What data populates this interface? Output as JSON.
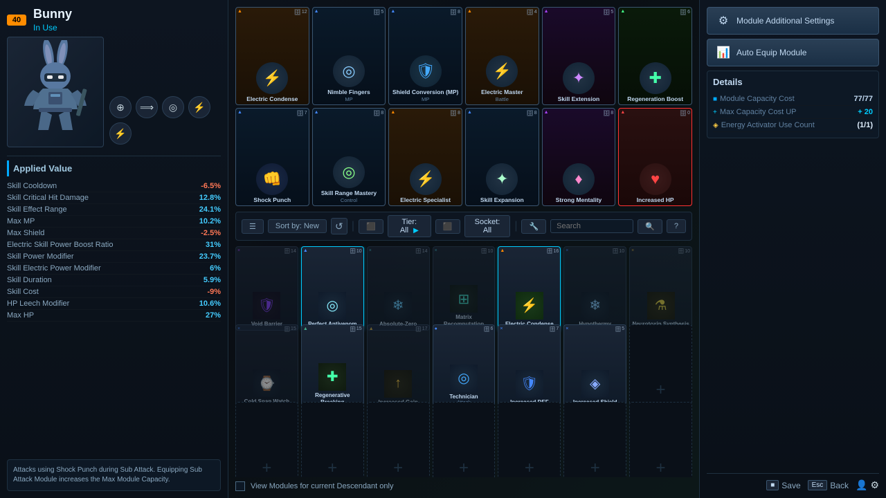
{
  "character": {
    "level": "40",
    "name": "Bunny",
    "status": "In Use"
  },
  "icons": {
    "target": "⊕",
    "arrow": "⟹",
    "settings": "⚙",
    "lightning": "⚡",
    "lightning2": "⚡",
    "shield_icon": "🛡",
    "refresh": "↺",
    "layers": "≡",
    "search": "🔍",
    "question": "?",
    "filter": "⊞",
    "checkbox_empty": "",
    "gear": "⚙",
    "bar": "▰",
    "save": "💾",
    "back_key": "Esc"
  },
  "equipped_modules": [
    {
      "name": "Electric Condense",
      "sub": "",
      "icon": "⚡",
      "badge": "12",
      "badge_left": "▲",
      "type": "orange"
    },
    {
      "name": "Nimble Fingers",
      "sub": "MP",
      "icon": "◎",
      "badge": "5",
      "badge_left": "▲",
      "type": "blue"
    },
    {
      "name": "Shield Conversion (MP)",
      "sub": "MP",
      "icon": "🛡",
      "badge": "8",
      "badge_left": "▲",
      "type": "blue"
    },
    {
      "name": "Electric Master",
      "sub": "Battle",
      "icon": "⚡",
      "badge": "4",
      "badge_left": "▲",
      "type": "orange"
    },
    {
      "name": "Skill Extension",
      "sub": "",
      "icon": "✦",
      "badge": "5",
      "badge_left": "▲",
      "type": "purple"
    },
    {
      "name": "Regeneration Boost",
      "sub": "",
      "icon": "✚",
      "badge": "6",
      "badge_left": "▲",
      "type": "green"
    },
    {
      "name": "Shock Punch",
      "sub": "",
      "icon": "👊",
      "badge": "7",
      "badge_left": "▲",
      "type": "blue"
    },
    {
      "name": "Skill Range Mastery",
      "sub": "Control",
      "icon": "◎",
      "badge": "8",
      "badge_left": "▲",
      "type": "blue"
    },
    {
      "name": "Electric Specialist",
      "sub": "",
      "icon": "⚡",
      "badge": "8",
      "badge_left": "▲",
      "type": "orange"
    },
    {
      "name": "Skill Expansion",
      "sub": "",
      "icon": "✦",
      "badge": "8",
      "badge_left": "▲",
      "type": "blue"
    },
    {
      "name": "Strong Mentality",
      "sub": "",
      "icon": "♦",
      "badge": "8",
      "badge_left": "▲",
      "type": "purple"
    },
    {
      "name": "Increased HP",
      "sub": "",
      "icon": "♥",
      "badge": "0",
      "badge_left": "▲",
      "type": "red"
    }
  ],
  "filter_bar": {
    "sort_label": "Sort by: New",
    "tier_label": "Tier: All",
    "socket_label": "Socket: All",
    "search_placeholder": "Search"
  },
  "inventory_modules": [
    {
      "name": "Void Barrier",
      "sub": "",
      "icon": "🛡",
      "badge": "14",
      "badge_left": "×",
      "type": "purple",
      "active": false,
      "dimmed": true
    },
    {
      "name": "Perfect Antivenom",
      "sub": "",
      "icon": "◎",
      "badge": "10",
      "badge_left": "▲",
      "type": "blue",
      "active": true,
      "dimmed": false
    },
    {
      "name": "Absolute-Zero",
      "sub": "",
      "icon": "❄",
      "badge": "14",
      "badge_left": "×",
      "type": "teal",
      "active": false,
      "dimmed": true
    },
    {
      "name": "Matrix Recomputation",
      "sub": "",
      "icon": "⊞",
      "badge": "10",
      "badge_left": "×",
      "type": "teal",
      "active": false,
      "dimmed": true
    },
    {
      "name": "Electric Condense",
      "sub": "",
      "icon": "⚡",
      "badge": "16",
      "badge_left": "▲",
      "type": "orange",
      "active": true,
      "dimmed": false
    },
    {
      "name": "Hypothermy",
      "sub": "",
      "icon": "❄",
      "badge": "10",
      "badge_left": "×",
      "type": "blue",
      "active": false,
      "dimmed": true
    },
    {
      "name": "Neurotoxin Synthesis",
      "sub": "",
      "icon": "⚗",
      "badge": "10",
      "badge_left": "×",
      "type": "orange",
      "active": false,
      "dimmed": true
    },
    {
      "name": "Cold Snap Watch",
      "sub": "",
      "icon": "⌚",
      "badge": "15",
      "badge_left": "×",
      "type": "blue",
      "active": false,
      "dimmed": true
    },
    {
      "name": "Regenerative Breaking",
      "sub": "",
      "icon": "✚",
      "badge": "15",
      "badge_left": "▲",
      "type": "green",
      "active": false,
      "dimmed": false
    },
    {
      "name": "Increased Gain",
      "sub": "",
      "icon": "↑",
      "badge": "17",
      "badge_left": "▲",
      "type": "orange",
      "active": false,
      "dimmed": true
    },
    {
      "name": "Technician",
      "sub": "Attack",
      "icon": "◎",
      "badge": "6",
      "badge_left": "●",
      "type": "blue",
      "active": false,
      "dimmed": false
    },
    {
      "name": "Increased DEF",
      "sub": "",
      "icon": "🛡",
      "badge": "7",
      "badge_left": "×",
      "type": "blue",
      "active": false,
      "dimmed": false
    },
    {
      "name": "Increased Shield",
      "sub": "",
      "icon": "◈",
      "badge": "5",
      "badge_left": "×",
      "type": "blue",
      "active": false,
      "dimmed": false
    },
    {
      "name": "",
      "sub": "",
      "icon": "+",
      "badge": "",
      "badge_left": "",
      "type": "empty",
      "active": false,
      "dimmed": false
    },
    {
      "name": "",
      "sub": "",
      "icon": "+",
      "badge": "",
      "badge_left": "",
      "type": "empty",
      "active": false,
      "dimmed": false
    },
    {
      "name": "",
      "sub": "",
      "icon": "+",
      "badge": "",
      "badge_left": "",
      "type": "empty",
      "active": false,
      "dimmed": false
    },
    {
      "name": "",
      "sub": "",
      "icon": "+",
      "badge": "",
      "badge_left": "",
      "type": "empty",
      "active": false,
      "dimmed": false
    },
    {
      "name": "",
      "sub": "",
      "icon": "+",
      "badge": "",
      "badge_left": "",
      "type": "empty",
      "active": false,
      "dimmed": false
    },
    {
      "name": "",
      "sub": "",
      "icon": "+",
      "badge": "",
      "badge_left": "",
      "type": "empty",
      "active": false,
      "dimmed": false
    },
    {
      "name": "",
      "sub": "",
      "icon": "+",
      "badge": "",
      "badge_left": "",
      "type": "empty",
      "active": false,
      "dimmed": false
    },
    {
      "name": "",
      "sub": "",
      "icon": "+",
      "badge": "",
      "badge_left": "",
      "type": "empty",
      "active": false,
      "dimmed": false
    }
  ],
  "stats": [
    {
      "name": "Skill Cooldown",
      "value": "-6.5%",
      "type": "negative"
    },
    {
      "name": "Skill Critical Hit Damage",
      "value": "12.8%",
      "type": "positive"
    },
    {
      "name": "Skill Effect Range",
      "value": "24.1%",
      "type": "positive"
    },
    {
      "name": "Max MP",
      "value": "10.2%",
      "type": "positive"
    },
    {
      "name": "Max Shield",
      "value": "-2.5%",
      "type": "negative"
    },
    {
      "name": "Electric Skill Power Boost Ratio",
      "value": "31%",
      "type": "positive"
    },
    {
      "name": "Skill Power Modifier",
      "value": "23.7%",
      "type": "positive"
    },
    {
      "name": "Skill Electric Power Modifier",
      "value": "6%",
      "type": "positive"
    },
    {
      "name": "Skill Duration",
      "value": "5.9%",
      "type": "positive"
    },
    {
      "name": "Skill Cost",
      "value": "-9%",
      "type": "negative"
    },
    {
      "name": "HP Leech Modifier",
      "value": "10.6%",
      "type": "positive"
    },
    {
      "name": "Max HP",
      "value": "27%",
      "type": "positive"
    }
  ],
  "description": "Attacks using Shock Punch during Sub Attack. Equipping Sub Attack Module increases the Max Module Capacity.",
  "applied_value_header": "Applied Value",
  "right_panel": {
    "module_settings_btn": "Module Additional Settings",
    "auto_equip_btn": "Auto Equip Module",
    "details_header": "Details",
    "module_capacity_cost_label": "Module Capacity Cost",
    "module_capacity_cost_value": "77/77",
    "max_capacity_label": "Max Capacity Cost UP",
    "max_capacity_value": "+ 20",
    "energy_activator_label": "Energy Activator Use Count",
    "energy_activator_value": "(1/1)"
  },
  "bottom": {
    "checkbox_label": "View Modules for current Descendant only"
  },
  "footer": {
    "save_label": "Save",
    "back_label": "Back"
  }
}
